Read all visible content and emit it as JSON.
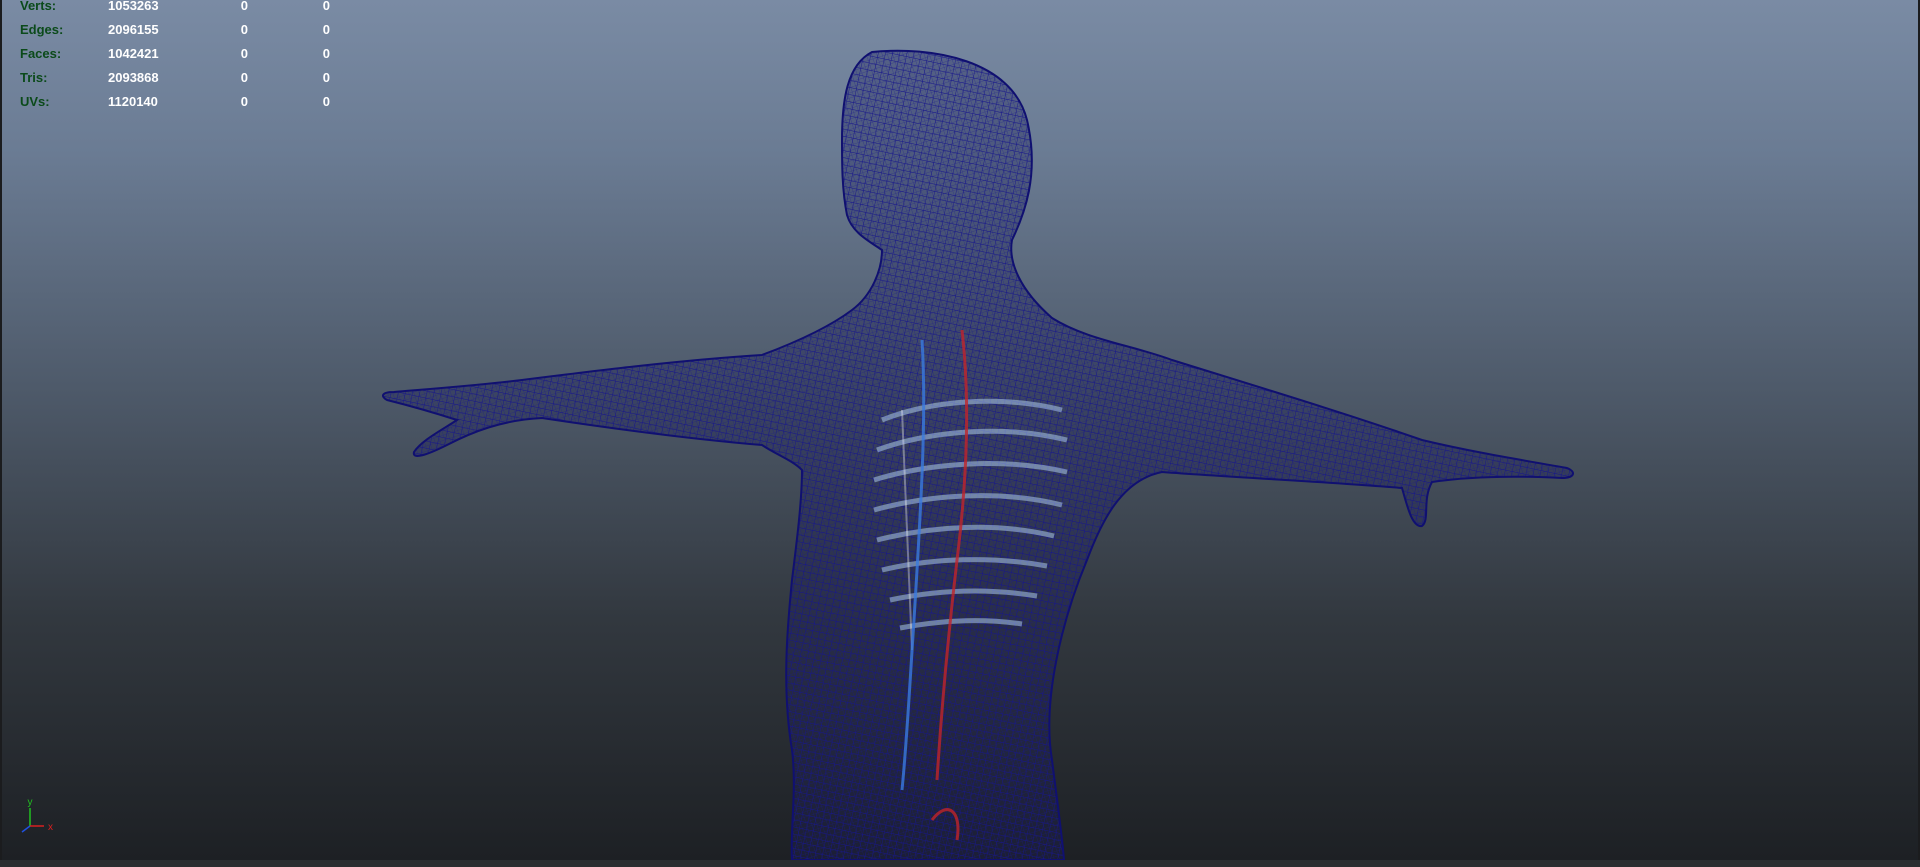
{
  "hud": {
    "rows": [
      {
        "label": "Verts:",
        "total": "1053263",
        "selected": "0",
        "components": "0"
      },
      {
        "label": "Edges:",
        "total": "2096155",
        "selected": "0",
        "components": "0"
      },
      {
        "label": "Faces:",
        "total": "1042421",
        "selected": "0",
        "components": "0"
      },
      {
        "label": "Tris:",
        "total": "2093868",
        "selected": "0",
        "components": "0"
      },
      {
        "label": "UVs:",
        "total": "1120140",
        "selected": "0",
        "components": "0"
      }
    ]
  },
  "axis_gizmo": {
    "y": "y",
    "x": "x"
  },
  "camera_label": "",
  "colors": {
    "wireframe": "#14137a",
    "hud_label": "#0b4a1a",
    "hud_value": "#ffffff",
    "gizmo_x": "#d92020",
    "gizmo_y": "#20c020",
    "gizmo_z": "#2050e0"
  },
  "viewport": {
    "shading": "wireframe",
    "model": "human anatomy t-pose"
  }
}
